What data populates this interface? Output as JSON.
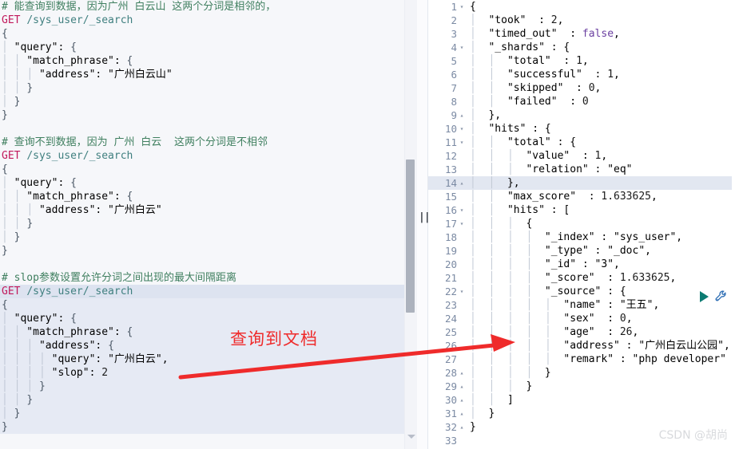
{
  "editor": {
    "blocks": [
      {
        "comment": "# 能查询到数据，因为广州 白云山 这两个分词是相邻的，",
        "method": "GET",
        "url": "/sys_user/_search",
        "body": [
          "{",
          "  \"query\": {",
          "    \"match_phrase\": {",
          "      \"address\": \"广州白云山\"",
          "    }",
          "  }",
          "}"
        ]
      },
      {
        "comment": "# 查询不到数据，因为 广州 白云  这两个分词是不相邻",
        "method": "GET",
        "url": "/sys_user/_search",
        "body": [
          "{",
          "  \"query\": {",
          "    \"match_phrase\": {",
          "      \"address\": \"广州白云\"",
          "    }",
          "  }",
          "}"
        ]
      },
      {
        "comment": "# slop参数设置允许分词之间出现的最大间隔距离",
        "method": "GET",
        "url": "/sys_user/_search",
        "body": [
          "{",
          "  \"query\": {",
          "    \"match_phrase\": {",
          "      \"address\": {",
          "        \"query\": \"广州白云\",",
          "        \"slop\": 2",
          "      }",
          "    }",
          "  }",
          "}"
        ]
      }
    ],
    "actions": {
      "run_label": "play-icon",
      "wrench_label": "wrench-icon"
    }
  },
  "result": {
    "lines": [
      {
        "n": 1,
        "fold": "▾",
        "indent": 0,
        "text": "{"
      },
      {
        "n": 2,
        "fold": "",
        "indent": 1,
        "text": "\"took\" : 2,"
      },
      {
        "n": 3,
        "fold": "",
        "indent": 1,
        "text": "\"timed_out\" : false,"
      },
      {
        "n": 4,
        "fold": "▾",
        "indent": 1,
        "text": "\"_shards\" : {"
      },
      {
        "n": 5,
        "fold": "",
        "indent": 2,
        "text": "\"total\" : 1,"
      },
      {
        "n": 6,
        "fold": "",
        "indent": 2,
        "text": "\"successful\" : 1,"
      },
      {
        "n": 7,
        "fold": "",
        "indent": 2,
        "text": "\"skipped\" : 0,"
      },
      {
        "n": 8,
        "fold": "",
        "indent": 2,
        "text": "\"failed\" : 0"
      },
      {
        "n": 9,
        "fold": "▴",
        "indent": 1,
        "text": "},"
      },
      {
        "n": 10,
        "fold": "▾",
        "indent": 1,
        "text": "\"hits\" : {"
      },
      {
        "n": 11,
        "fold": "▾",
        "indent": 2,
        "text": "\"total\" : {"
      },
      {
        "n": 12,
        "fold": "",
        "indent": 3,
        "text": "\"value\" : 1,"
      },
      {
        "n": 13,
        "fold": "",
        "indent": 3,
        "text": "\"relation\" : \"eq\""
      },
      {
        "n": 14,
        "fold": "▴",
        "indent": 2,
        "text": "},"
      },
      {
        "n": 15,
        "fold": "",
        "indent": 2,
        "text": "\"max_score\" : 1.633625,"
      },
      {
        "n": 16,
        "fold": "▾",
        "indent": 2,
        "text": "\"hits\" : ["
      },
      {
        "n": 17,
        "fold": "▾",
        "indent": 3,
        "text": "{"
      },
      {
        "n": 18,
        "fold": "",
        "indent": 4,
        "text": "\"_index\" : \"sys_user\","
      },
      {
        "n": 19,
        "fold": "",
        "indent": 4,
        "text": "\"_type\" : \"_doc\","
      },
      {
        "n": 20,
        "fold": "",
        "indent": 4,
        "text": "\"_id\" : \"3\","
      },
      {
        "n": 21,
        "fold": "",
        "indent": 4,
        "text": "\"_score\" : 1.633625,"
      },
      {
        "n": 22,
        "fold": "▾",
        "indent": 4,
        "text": "\"_source\" : {"
      },
      {
        "n": 23,
        "fold": "",
        "indent": 5,
        "text": "\"name\" : \"王五\","
      },
      {
        "n": 24,
        "fold": "",
        "indent": 5,
        "text": "\"sex\" : 0,"
      },
      {
        "n": 25,
        "fold": "",
        "indent": 5,
        "text": "\"age\" : 26,"
      },
      {
        "n": 26,
        "fold": "",
        "indent": 5,
        "text": "\"address\" : \"广州白云山公园\","
      },
      {
        "n": 27,
        "fold": "",
        "indent": 5,
        "text": "\"remark\" : \"php developer\""
      },
      {
        "n": 28,
        "fold": "▴",
        "indent": 4,
        "text": "}"
      },
      {
        "n": 29,
        "fold": "▴",
        "indent": 3,
        "text": "}"
      },
      {
        "n": 30,
        "fold": "▴",
        "indent": 2,
        "text": "]"
      },
      {
        "n": 31,
        "fold": "▴",
        "indent": 1,
        "text": "}"
      },
      {
        "n": 32,
        "fold": "▴",
        "indent": 0,
        "text": "}"
      },
      {
        "n": 33,
        "fold": "",
        "indent": 0,
        "text": ""
      }
    ],
    "active_line": 14
  },
  "annotation": {
    "label": "查询到文档",
    "color": "#ef2b2b"
  },
  "watermark": {
    "text": "CSDN @胡尚"
  },
  "colors": {
    "comment": "#3f7f5f",
    "method": "#c1185b",
    "url": "#3f7f7f",
    "key": "#2a7ab0",
    "string": "#1f7a3d",
    "boolean": "#6a3fa0",
    "selection": "#e6eaf4",
    "active_line": "#e2e7f1",
    "gutter_text": "#7b8aa3",
    "play": "#0c7b72",
    "wrench": "#2f6fb5"
  }
}
